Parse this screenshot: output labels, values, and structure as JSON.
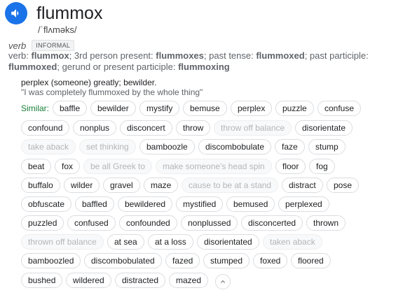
{
  "entry": {
    "word": "flummox",
    "phonetic": "/ˈflʌməks/",
    "part_of_speech": "verb",
    "register": "INFORMAL",
    "forms_prefix": "verb: ",
    "forms": [
      {
        "text": "flummox",
        "bold": true
      },
      {
        "text": "; 3rd person present: ",
        "bold": false
      },
      {
        "text": "flummoxes",
        "bold": true
      },
      {
        "text": "; past tense: ",
        "bold": false
      },
      {
        "text": "flummoxed",
        "bold": true
      },
      {
        "text": "; past participle: ",
        "bold": false
      },
      {
        "text": "flummoxed",
        "bold": true
      },
      {
        "text": "; gerund or present participle: ",
        "bold": false
      },
      {
        "text": "flummoxing",
        "bold": true
      }
    ],
    "definition": "perplex (someone) greatly; bewilder.",
    "example": "\"I was completely flummoxed by the whole thing\""
  },
  "similar_label": "Similar:",
  "chip_rows": [
    [
      {
        "text": "baffle"
      },
      {
        "text": "bewilder"
      },
      {
        "text": "mystify"
      },
      {
        "text": "bemuse"
      },
      {
        "text": "perplex"
      },
      {
        "text": "puzzle"
      },
      {
        "text": "confuse"
      }
    ],
    [
      {
        "text": "confound"
      },
      {
        "text": "nonplus"
      },
      {
        "text": "disconcert"
      },
      {
        "text": "throw"
      },
      {
        "text": "throw off balance",
        "muted": true
      },
      {
        "text": "disorientate"
      }
    ],
    [
      {
        "text": "take aback",
        "muted": true
      },
      {
        "text": "set thinking",
        "muted": true
      },
      {
        "text": "bamboozle"
      },
      {
        "text": "discombobulate"
      },
      {
        "text": "faze"
      },
      {
        "text": "stump"
      }
    ],
    [
      {
        "text": "beat"
      },
      {
        "text": "fox"
      },
      {
        "text": "be all Greek to",
        "muted": true
      },
      {
        "text": "make someone's head spin",
        "muted": true
      },
      {
        "text": "floor"
      },
      {
        "text": "fog"
      }
    ],
    [
      {
        "text": "buffalo"
      },
      {
        "text": "wilder"
      },
      {
        "text": "gravel"
      },
      {
        "text": "maze"
      },
      {
        "text": "cause to be at a stand",
        "muted": true
      },
      {
        "text": "distract"
      },
      {
        "text": "pose"
      }
    ],
    [
      {
        "text": "obfuscate"
      },
      {
        "text": "baffled"
      },
      {
        "text": "bewildered"
      },
      {
        "text": "mystified"
      },
      {
        "text": "bemused"
      },
      {
        "text": "perplexed"
      }
    ],
    [
      {
        "text": "puzzled"
      },
      {
        "text": "confused"
      },
      {
        "text": "confounded"
      },
      {
        "text": "nonplussed"
      },
      {
        "text": "disconcerted"
      },
      {
        "text": "thrown"
      }
    ],
    [
      {
        "text": "thrown off balance",
        "muted": true
      },
      {
        "text": "at sea"
      },
      {
        "text": "at a loss"
      },
      {
        "text": "disorientated"
      },
      {
        "text": "taken aback",
        "muted": true
      }
    ],
    [
      {
        "text": "bamboozled"
      },
      {
        "text": "discombobulated"
      },
      {
        "text": "fazed"
      },
      {
        "text": "stumped"
      },
      {
        "text": "foxed"
      },
      {
        "text": "floored"
      }
    ],
    [
      {
        "text": "bushed"
      },
      {
        "text": "wildered"
      },
      {
        "text": "distracted"
      },
      {
        "text": "mazed"
      }
    ]
  ],
  "colors": {
    "accent": "#1a73e8",
    "similar_label": "#188038"
  },
  "icons": {
    "audio": "speaker-icon",
    "collapse": "chevron-up-icon"
  }
}
